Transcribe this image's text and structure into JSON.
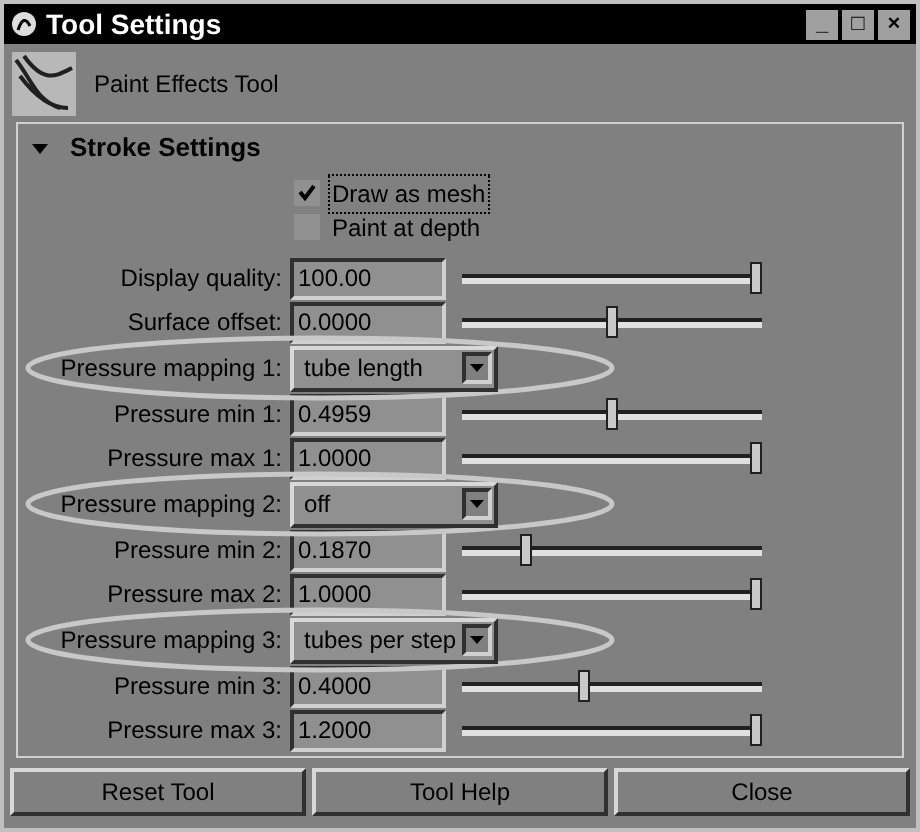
{
  "window": {
    "title": "Tool Settings",
    "controls": [
      "_",
      "□",
      "×"
    ]
  },
  "tool": {
    "name": "Paint Effects Tool"
  },
  "section": {
    "title": "Stroke Settings",
    "expanded": true
  },
  "checkboxes": [
    {
      "label": "Draw as mesh",
      "checked": true,
      "focused": true
    },
    {
      "label": "Paint at depth",
      "checked": false,
      "focused": false
    }
  ],
  "rows": [
    {
      "kind": "slider",
      "label": "Display quality:",
      "value": "100.00",
      "level": 1.0
    },
    {
      "kind": "slider",
      "label": "Surface offset:",
      "value": "0.0000",
      "level": 0.5
    },
    {
      "kind": "dropdown",
      "label": "Pressure mapping 1:",
      "value": "tube length",
      "highlighted": true
    },
    {
      "kind": "slider",
      "label": "Pressure min 1:",
      "value": "0.4959",
      "level": 0.5
    },
    {
      "kind": "slider",
      "label": "Pressure max 1:",
      "value": "1.0000",
      "level": 1.0
    },
    {
      "kind": "dropdown",
      "label": "Pressure mapping 2:",
      "value": "off",
      "highlighted": true
    },
    {
      "kind": "slider",
      "label": "Pressure min 2:",
      "value": "0.1870",
      "level": 0.2
    },
    {
      "kind": "slider",
      "label": "Pressure max 2:",
      "value": "1.0000",
      "level": 1.0
    },
    {
      "kind": "dropdown",
      "label": "Pressure mapping 3:",
      "value": "tubes per step",
      "highlighted": true
    },
    {
      "kind": "slider",
      "label": "Pressure min 3:",
      "value": "0.4000",
      "level": 0.4
    },
    {
      "kind": "slider",
      "label": "Pressure max 3:",
      "value": "1.2000",
      "level": 1.0
    }
  ],
  "buttons": [
    "Reset Tool",
    "Tool Help",
    "Close"
  ]
}
